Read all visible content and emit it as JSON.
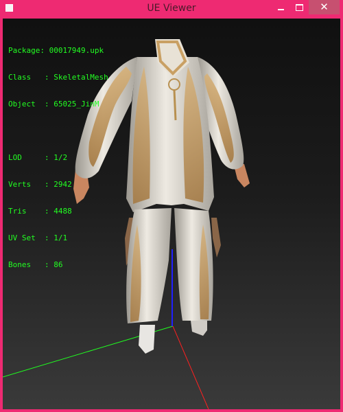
{
  "window": {
    "title": "UE Viewer"
  },
  "controls": {
    "minimize_icon": "minimize-icon",
    "maximize_icon": "maximize-icon",
    "close_icon": "close-icon"
  },
  "info_panel": {
    "package": "Package: 00017949.upk",
    "class": "Class   : SkeletalMesh",
    "object": "Object  : 65025_JinM",
    "lod": "LOD     : 1/2",
    "verts": "Verts   : 2942",
    "tris": "Tris    : 4488",
    "uvset": "UV Set  : 1/1",
    "bones": "Bones   : 86"
  },
  "colors": {
    "frame_accent": "#ee2a72",
    "info_text": "#22ff22",
    "axis_x": "#ff2020",
    "axis_y": "#20ff20",
    "axis_z": "#2020ff"
  }
}
